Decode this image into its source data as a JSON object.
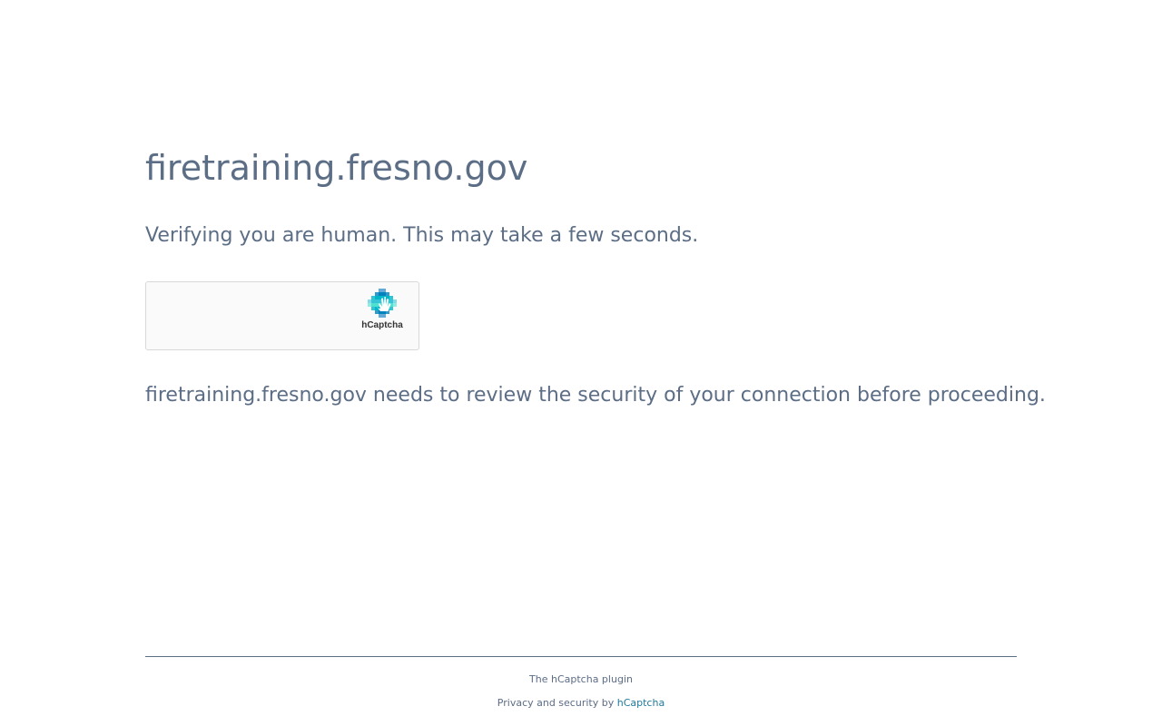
{
  "page": {
    "site_title": "firetraining.fresno.gov",
    "verify_message": "Verifying you are human. This may take a few seconds.",
    "review_message": "firetraining.fresno.gov needs to review the security of your connection before proceeding."
  },
  "captcha": {
    "logo_text": "hCaptcha",
    "logo_icon": "hcaptcha-hand-icon",
    "accent_colors": [
      "#0074bf",
      "#0082bf",
      "#00b6c9",
      "#37c4d7",
      "#4de1d2"
    ]
  },
  "footer": {
    "plugin_text": "The hCaptcha plugin",
    "privacy_prefix": "Privacy and security by",
    "privacy_link_label": "hCaptcha"
  }
}
